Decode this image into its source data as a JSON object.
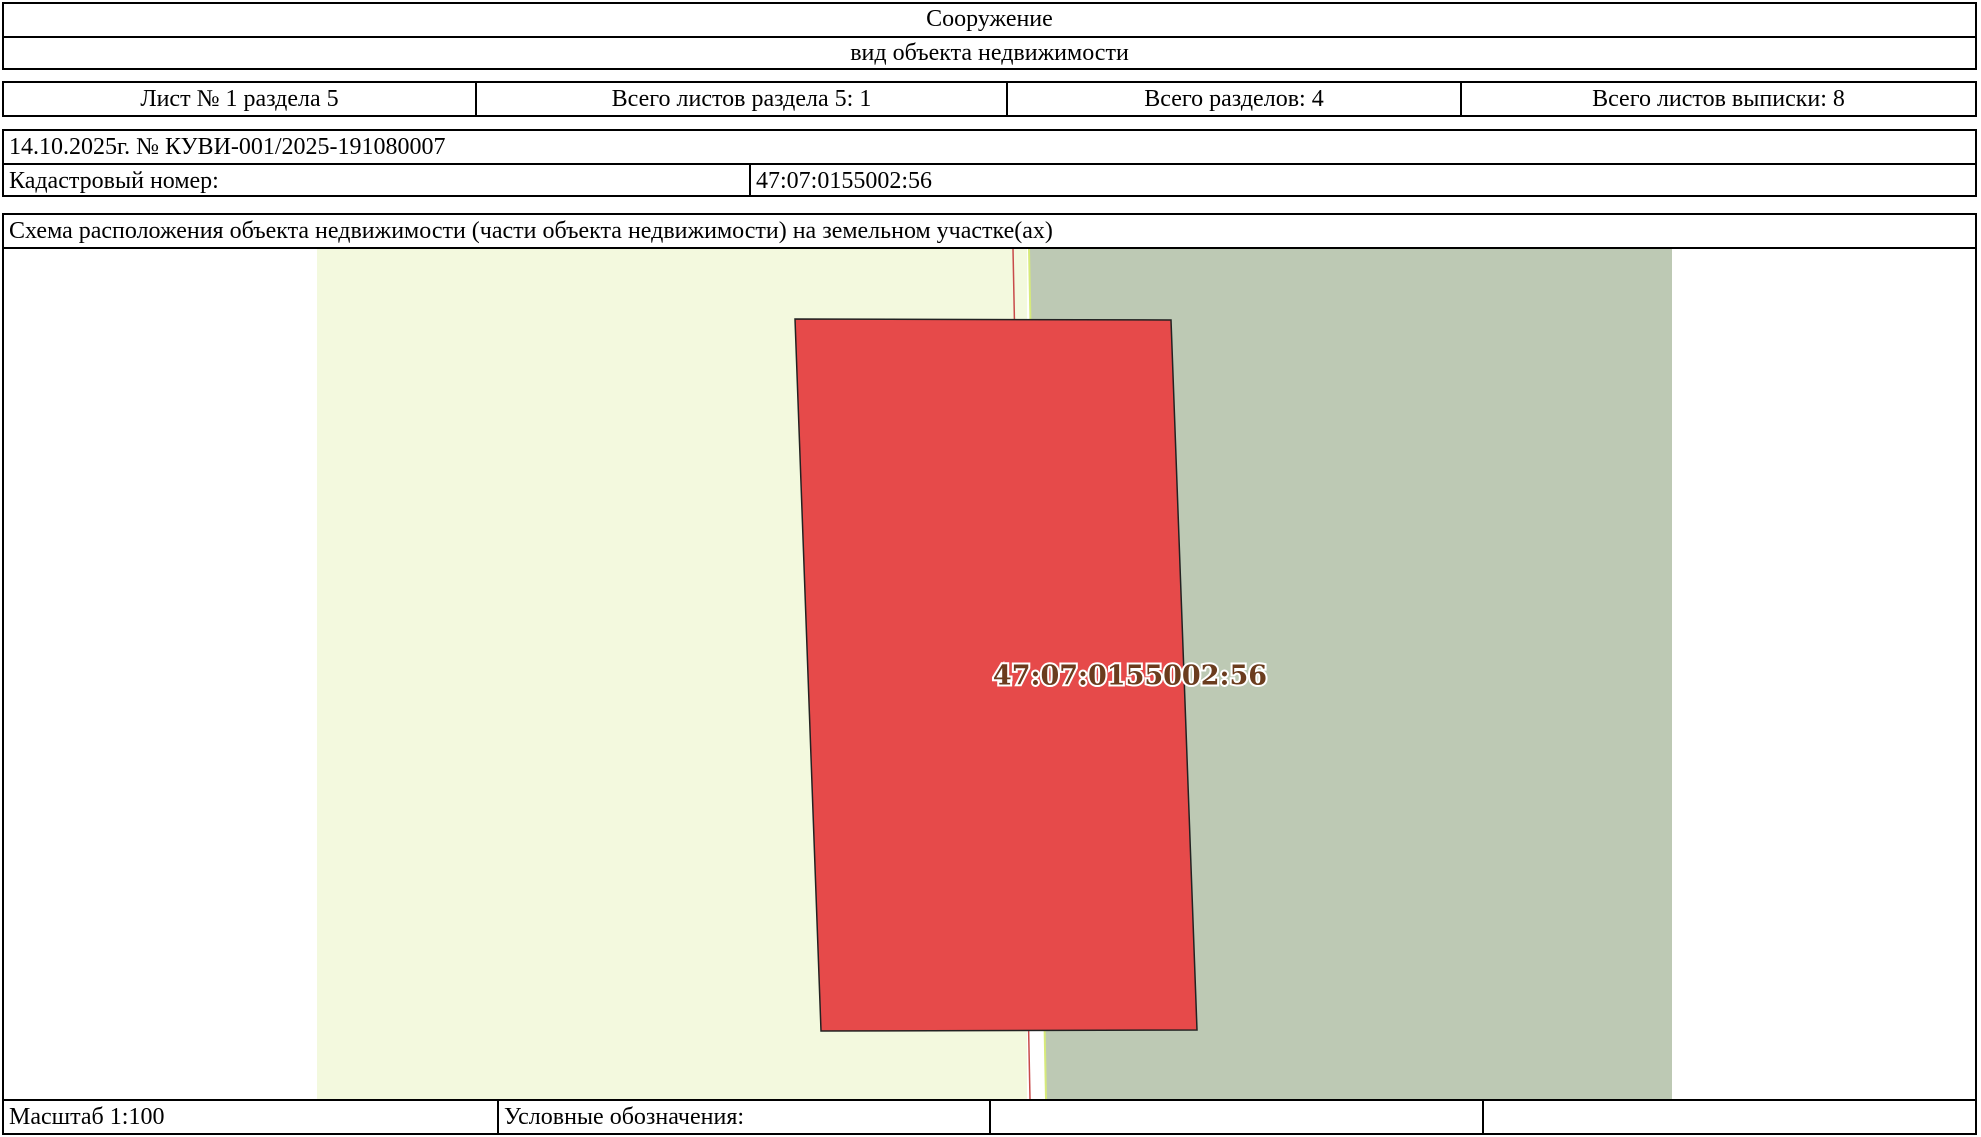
{
  "header": {
    "object_type": "Сооружение",
    "object_kind_caption": "вид объекта недвижимости"
  },
  "sheets": {
    "sheet_number": "Лист № 1 раздела 5",
    "total_sheets_section": "Всего листов раздела 5: 1",
    "total_sections": "Всего разделов: 4",
    "total_sheets_extract": "Всего листов выписки: 8"
  },
  "info": {
    "date_number": "14.10.2025г. № КУВИ-001/2025-191080007",
    "cadastral_label": "Кадастровый номер:",
    "cadastral_value": "47:07:0155002:56"
  },
  "scheme": {
    "title": "Схема расположения объекта недвижимости (части объекта недвижимости) на земельном участке(ах)",
    "map": {
      "object_label": "47:07:0155002:56",
      "colors": {
        "land_left": "#f3f9de",
        "land_right": "#bdc9b4",
        "object_fill": "#e64a4a",
        "boundary_line": "#c84a4a",
        "label_fill": "#6b3c1e"
      }
    },
    "footer": {
      "scale": "Масштаб 1:100",
      "legend_label": "Условные обозначения:",
      "legend_item_1": "",
      "legend_item_2": ""
    }
  }
}
